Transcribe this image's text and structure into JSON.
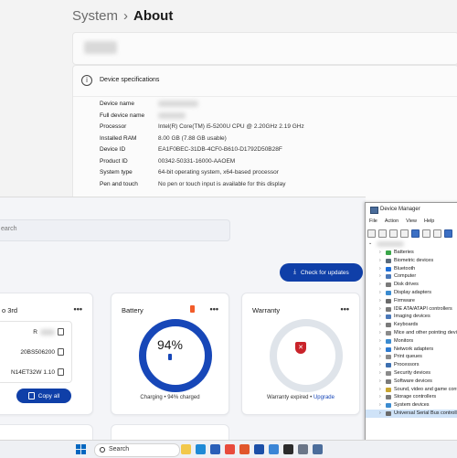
{
  "settings": {
    "breadcrumb_parent": "System",
    "breadcrumb_sep": "›",
    "page_title": "About",
    "spec_title": "Device specifications",
    "specs": [
      {
        "key": "Device name",
        "value": ""
      },
      {
        "key": "Full device name",
        "value": ""
      },
      {
        "key": "Processor",
        "value": "Intel(R) Core(TM) i5-5200U CPU @ 2.20GHz   2.19 GHz"
      },
      {
        "key": "Installed RAM",
        "value": "8.00 GB (7.88 GB usable)"
      },
      {
        "key": "Device ID",
        "value": "EA1F0BEC-31DB-4CF0-B610-D1792D50B28F"
      },
      {
        "key": "Product ID",
        "value": "00342-50331-16000-AAOEM"
      },
      {
        "key": "System type",
        "value": "64-bit operating system, x64-based processor"
      },
      {
        "key": "Pen and touch",
        "value": "No pen or touch input is available for this display"
      }
    ]
  },
  "support": {
    "search_placeholder": "earch",
    "update_button": "Check for updates",
    "device_card": {
      "title": "o 3rd",
      "serial": "R",
      "product": "20BS506200",
      "bios": "N14ET32W 1.10",
      "copy_all": "Copy all"
    },
    "battery_card": {
      "title": "Battery",
      "percent": "94%",
      "percent_value": 94,
      "footer": "Charging • 94% charged"
    },
    "warranty_card": {
      "title": "Warranty",
      "footer_prefix": "Warranty expired • ",
      "footer_link": "Upgrade"
    },
    "menu_dots": "•••"
  },
  "device_manager": {
    "title": "Device Manager",
    "menu": [
      "File",
      "Action",
      "View",
      "Help"
    ],
    "items": [
      "Batteries",
      "Biometric devices",
      "Bluetooth",
      "Computer",
      "Disk drives",
      "Display adapters",
      "Firmware",
      "IDE ATA/ATAPI controllers",
      "Imaging devices",
      "Keyboards",
      "Mice and other pointing devices",
      "Monitors",
      "Network adapters",
      "Print queues",
      "Processors",
      "Security devices",
      "Software devices",
      "Sound, video and game controllers",
      "Storage controllers",
      "System devices",
      "Universal Serial Bus controllers"
    ],
    "selected_item": "Universal Serial Bus controllers",
    "icon_colors": [
      "#3aa64a",
      "#5b6b7b",
      "#1e6fd9",
      "#4a78b8",
      "#7a7a7a",
      "#3b8bd0",
      "#6a6a6a",
      "#7a7a7a",
      "#4a78b8",
      "#7a7a7a",
      "#8a8a8a",
      "#3b8bd0",
      "#2e7bd1",
      "#8a8a8a",
      "#3c6fb0",
      "#8a8a8a",
      "#7a7a7a",
      "#c9a530",
      "#7a7a7a",
      "#3b8bd0",
      "#6a6a6a"
    ]
  },
  "taskbar": {
    "search_label": "Search",
    "apps": [
      {
        "name": "file-explorer-icon",
        "color": "#f2c84b"
      },
      {
        "name": "edge-icon",
        "color": "#1f8ad6"
      },
      {
        "name": "store-icon",
        "color": "#2a5fb8"
      },
      {
        "name": "chrome-icon",
        "color": "#e84b3c"
      },
      {
        "name": "media-player-icon",
        "color": "#e1562b"
      },
      {
        "name": "lenovo-icon",
        "color": "#1b4fa8"
      },
      {
        "name": "mail-icon",
        "color": "#3a85d6"
      },
      {
        "name": "terminal-icon",
        "color": "#2b2b2b"
      },
      {
        "name": "settings-icon",
        "color": "#6b7688"
      },
      {
        "name": "device-manager-icon",
        "color": "#4b6d9b"
      }
    ]
  }
}
